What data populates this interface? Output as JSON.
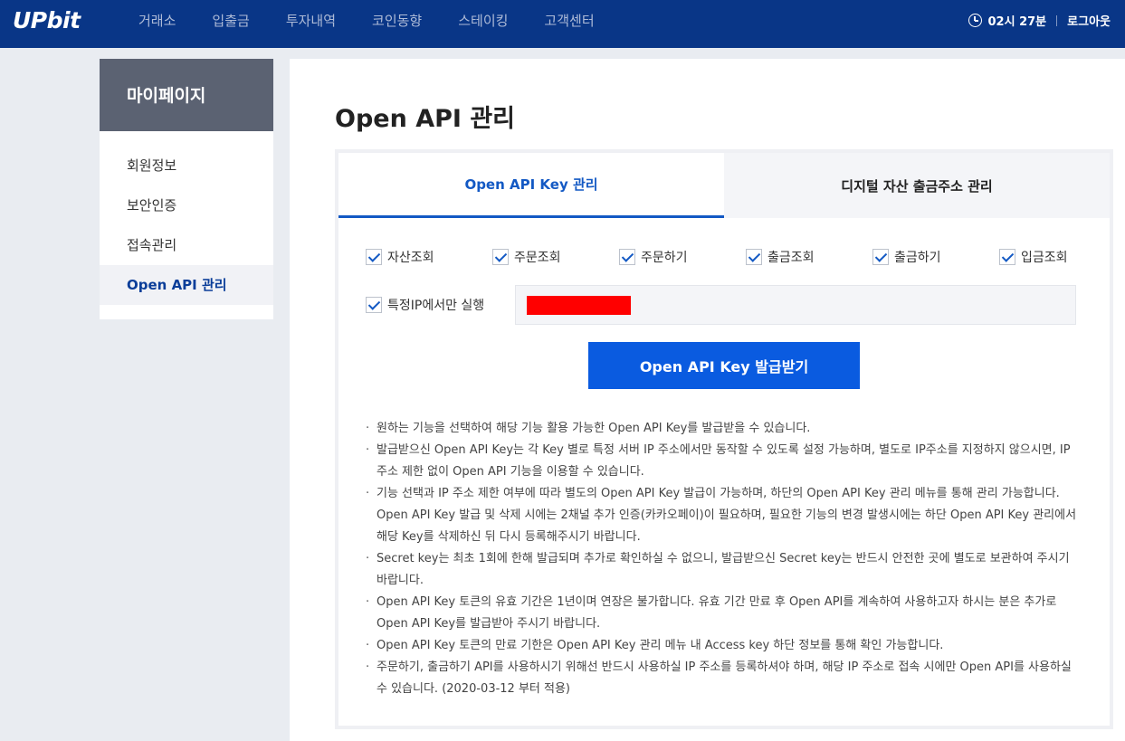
{
  "header": {
    "logo": "UPbit",
    "nav": [
      "거래소",
      "입출금",
      "투자내역",
      "코인동향",
      "스테이킹",
      "고객센터"
    ],
    "time": "02시 27분",
    "logout": "로그아웃"
  },
  "sidebar": {
    "title": "마이페이지",
    "items": [
      "회원정보",
      "보안인증",
      "접속관리",
      "Open API 관리"
    ]
  },
  "main": {
    "title": "Open API 관리",
    "tabs": [
      "Open API Key 관리",
      "디지털 자산 출금주소 관리"
    ],
    "permissions": [
      "자산조회",
      "주문조회",
      "주문하기",
      "출금조회",
      "출금하기",
      "입금조회"
    ],
    "ip_label": "특정IP에서만 실행",
    "issue_button": "Open API Key 발급받기",
    "notes": [
      "원하는 기능을 선택하여 해당 기능 활용 가능한 Open API Key를 발급받을 수 있습니다.",
      "발급받으신 Open API Key는 각 Key 별로 특정 서버 IP 주소에서만 동작할 수 있도록 설정 가능하며, 별도로 IP주소를 지정하지 않으시면, IP 주소 제한 없이 Open API 기능을 이용할 수 있습니다.",
      "기능 선택과 IP 주소 제한 여부에 따라 별도의 Open API Key 발급이 가능하며, 하단의 Open API Key 관리 메뉴를 통해 관리 가능합니다. Open API Key 발급 및 삭제 시에는 2채널 추가 인증(카카오페이)이 필요하며, 필요한 기능의 변경 발생시에는 하단 Open API Key 관리에서 해당 Key를 삭제하신 뒤 다시 등록해주시기 바랍니다.",
      "Secret key는 최초 1회에 한해 발급되며 추가로 확인하실 수 없으니, 발급받으신 Secret key는 반드시 안전한 곳에 별도로 보관하여 주시기 바랍니다.",
      "Open API Key 토큰의 유효 기간은 1년이며 연장은 불가합니다. 유효 기간 만료 후 Open API를 계속하여 사용하고자 하시는 분은 추가로 Open API Key를 발급받아 주시기 바랍니다.",
      "Open API Key 토큰의 만료 기한은 Open API Key 관리 메뉴 내 Access key 하단 정보를 통해 확인 가능합니다.",
      "주문하기, 출금하기 API를 사용하시기 위해선 반드시 사용하실 IP 주소를 등록하셔야 하며, 해당 IP 주소로 접속 시에만 Open API를 사용하실 수 있습니다. (2020-03-12 부터 적용)"
    ]
  }
}
